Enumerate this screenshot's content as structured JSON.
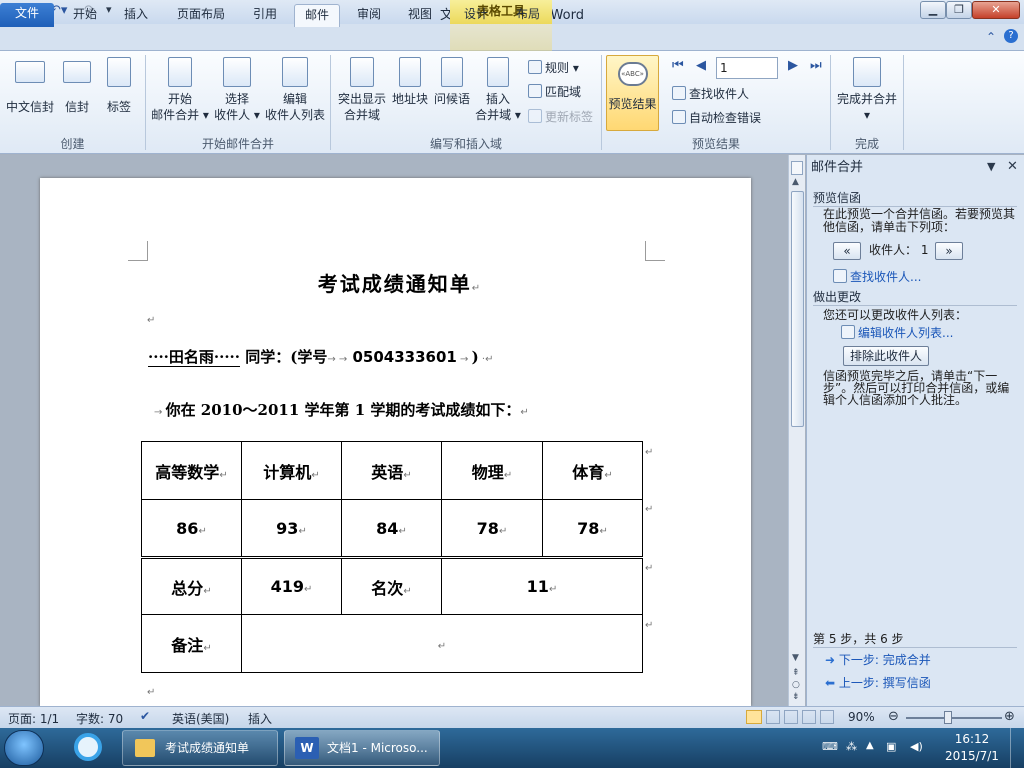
{
  "window": {
    "title": "文档1 - Microsoft Word",
    "table_tools": "表格工具"
  },
  "tabs": [
    "文件",
    "开始",
    "插入",
    "页面布局",
    "引用",
    "邮件",
    "审阅",
    "视图",
    "设计",
    "布局"
  ],
  "ribbon": {
    "create": {
      "label": "创建",
      "buttons": [
        "中文信封",
        "信封",
        "标签"
      ]
    },
    "start_merge": {
      "label": "开始邮件合并",
      "buttons": [
        {
          "l1": "开始",
          "l2": "邮件合并 ▾"
        },
        {
          "l1": "选择",
          "l2": "收件人 ▾"
        },
        {
          "l1": "编辑",
          "l2": "收件人列表"
        }
      ]
    },
    "write_insert": {
      "label": "编写和插入域",
      "buttons": [
        {
          "l1": "突出显示",
          "l2": "合并域"
        },
        {
          "l1": "地址块",
          "l2": ""
        },
        {
          "l1": "问候语",
          "l2": ""
        },
        {
          "l1": "插入",
          "l2": "合并域 ▾"
        }
      ],
      "small": [
        "规则 ▾",
        "匹配域",
        "更新标签"
      ]
    },
    "preview": {
      "label": "预览结果",
      "button": "预览结果",
      "record": "1",
      "small": [
        "查找收件人",
        "自动检查错误"
      ]
    },
    "finish": {
      "label": "完成",
      "l1": "完成并合并",
      "l2": "▾"
    }
  },
  "document": {
    "title": "考试成绩通知单",
    "line1_name": "····田名雨·····",
    "line1_mid": " 同学：(学号",
    "line1_id": "0504333601",
    "line1_end": ")",
    "line2": "你在 2010～2011 学年第 1 学期的考试成绩如下：",
    "subjects": [
      "高等数学",
      "计算机",
      "英语",
      "物理",
      "体育"
    ],
    "scores": [
      "86",
      "93",
      "84",
      "78",
      "78"
    ],
    "total_label": "总分",
    "total": "419",
    "rank_label": "名次",
    "rank": "11",
    "note_label": "备注"
  },
  "pane": {
    "title": "邮件合并",
    "preview_head": "预览信函",
    "preview_text": "在此预览一个合并信函。若要预览其他信函，请单击下列项：",
    "recipient": "收件人：  1",
    "find": "查找收件人...",
    "changes_head": "做出更改",
    "changes_text": "您还可以更改收件人列表：",
    "edit_list": "编辑收件人列表...",
    "exclude": "排除此收件人",
    "finish_text": "信函预览完毕之后，请单击“下一步”。然后可以打印合并信函，或编辑个人信函添加个人批注。",
    "step": "第 5 步，共 6 步",
    "next": "下一步: 完成合并",
    "prev": "上一步: 撰写信函"
  },
  "status": {
    "page": "页面: 1/1",
    "words": "字数: 70",
    "lang": "英语(美国)",
    "mode": "插入",
    "zoom": "90%"
  },
  "taskbar": {
    "item1": "考试成绩通知单",
    "item2": "文档1 - Microso...",
    "time": "16:12",
    "date": "2015/7/1"
  },
  "colors": {
    "file_tab": "#1f5fb8",
    "table_tools": "#ecd95b",
    "link": "#1a56b8"
  }
}
